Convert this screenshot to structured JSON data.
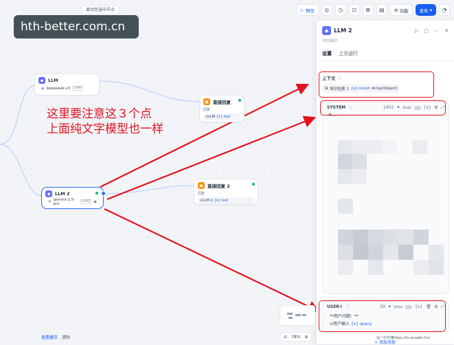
{
  "topbar": {
    "hint": "滚动至选中节点",
    "preview_label": "预览",
    "features_label": "功能",
    "publish_label": "发布"
  },
  "watermark": "hth-better.com.cn",
  "nodes": {
    "llm1": {
      "title": "LLM",
      "model": "deepseek-v3",
      "tag": "CHAT"
    },
    "llm2": {
      "title": "LLM 2",
      "model": "gemini-2.5-pro",
      "tag": "CHAT"
    },
    "answer1": {
      "title": "直接回复",
      "label": "回复",
      "node_ref": "LLM",
      "var": "{x} text"
    },
    "answer2": {
      "title": "直接回复 2",
      "label": "回复",
      "node_ref": "LLM 2",
      "var": "{x} text"
    }
  },
  "annotation": {
    "line1": "这里要注意这３个点",
    "line2": "上面纯文字模型也一样"
  },
  "panel": {
    "title": "LLM 2",
    "description_placeholder": "添加描述...",
    "tabs": [
      "设置",
      "上次运行"
    ],
    "context": {
      "title": "上下文",
      "chip_source": "知识检索 2",
      "chip_var": "{x} result",
      "chip_type": "Array[Object]"
    },
    "system": {
      "role": "SYSTEM",
      "tokens": "2402",
      "jinja": "Jinja",
      "first_line": "# ..."
    },
    "user": {
      "role": "USER",
      "tokens": "29",
      "jinja": "Jinja",
      "line1": "**用户问题：**",
      "chip_ref": "用户输入",
      "chip_var": "{x} query"
    },
    "add_message": "+ 添加消息"
  },
  "bottom": {
    "view_cache": "查看缓存",
    "clear": "清除",
    "zoom": "78%"
  },
  "credit": "@一只牛博https://hi.acowbo.fun",
  "colors": {
    "accent": "#155eef",
    "annotation_red": "#e5121e",
    "success": "#12b76a",
    "llm_icon": "#6172f3",
    "answer_icon": "#f79009"
  }
}
